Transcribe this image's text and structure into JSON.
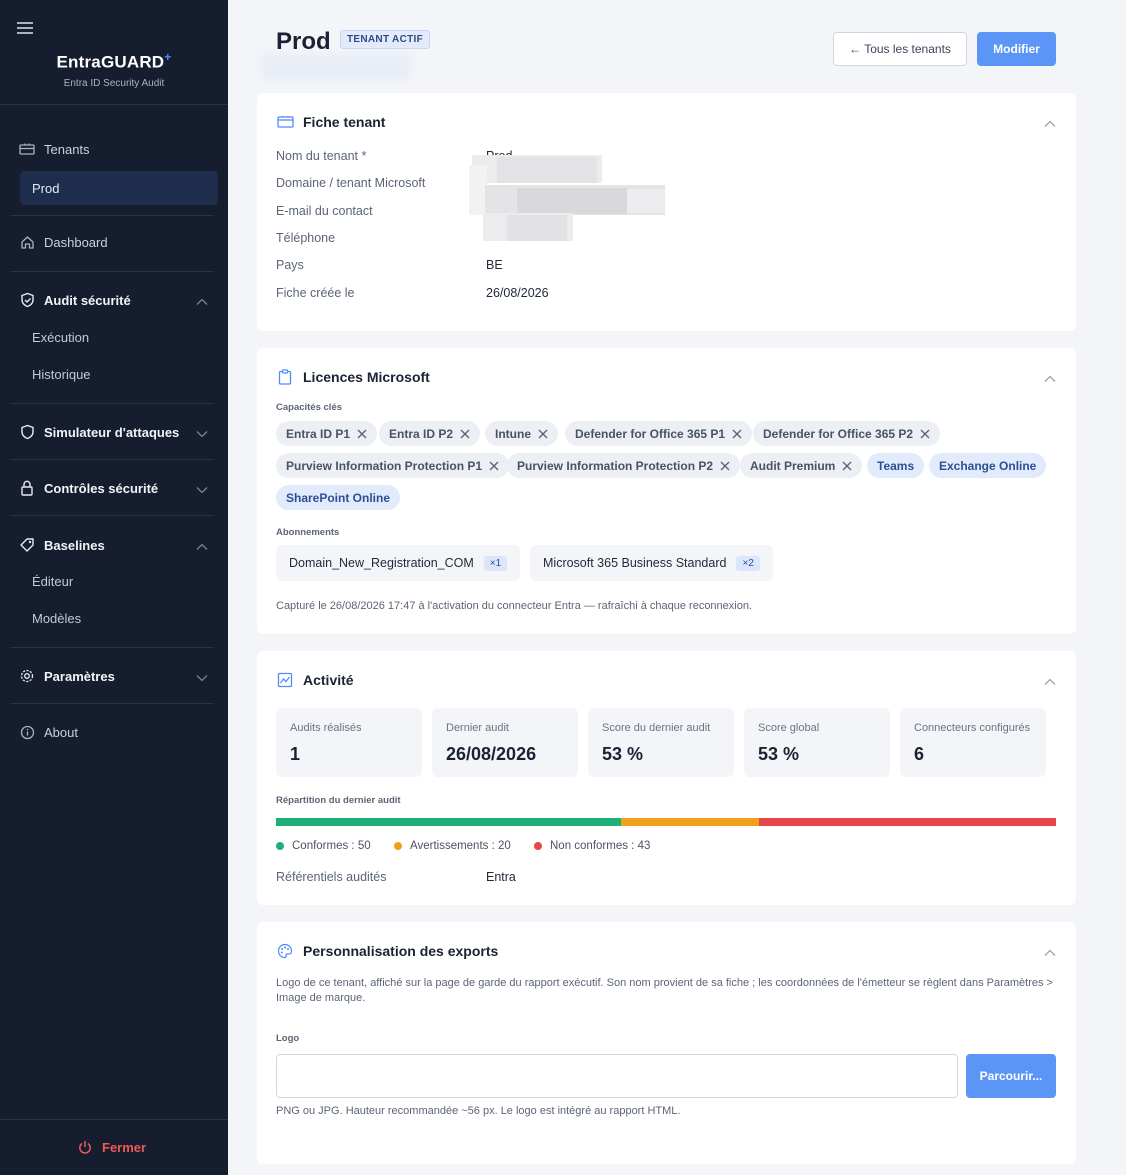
{
  "app": {
    "name": "EntraGUARD",
    "name_mark": "+",
    "subtitle": "Entra ID Security Audit"
  },
  "colors": {
    "sidebar_bg": "#151d2e",
    "accent": "#5b95f5",
    "danger": "#ef5a55",
    "ok": "#1fb07a",
    "warn": "#f1a01e",
    "fail": "#e84545"
  },
  "sidebar": {
    "tenants": "Tenants",
    "active_tenant": "Prod",
    "dashboard": "Dashboard",
    "audit": "Audit sécurité",
    "audit_children": [
      "Exécution",
      "Historique"
    ],
    "simulator": "Simulateur d'attaques",
    "controls": "Contrôles sécurité",
    "baselines": "Baselines",
    "baselines_children": [
      "Éditeur",
      "Modèles"
    ],
    "settings": "Paramètres",
    "about": "About",
    "logout": "Fermer"
  },
  "header": {
    "title": "Prod",
    "badge": "TENANT ACTIF",
    "back_button": "← Tous les tenants",
    "edit_button": "Modifier"
  },
  "fiche": {
    "title": "Fiche tenant",
    "fields": [
      {
        "label": "Nom du tenant *",
        "value": "Prod"
      },
      {
        "label": "Domaine / tenant Microsoft",
        "value": ""
      },
      {
        "label": "E-mail du contact",
        "value": ""
      },
      {
        "label": "Téléphone",
        "value": ""
      },
      {
        "label": "Pays",
        "value": "BE"
      },
      {
        "label": "Fiche créée le",
        "value": "26/08/2026"
      }
    ]
  },
  "licences": {
    "title": "Licences Microsoft",
    "capabilities_label": "Capacités clés",
    "capabilities": [
      {
        "label": "Entra ID P1",
        "removable": true
      },
      {
        "label": "Entra ID P2",
        "removable": true
      },
      {
        "label": "Intune",
        "removable": true
      },
      {
        "label": "Defender for Office 365 P1",
        "removable": true
      },
      {
        "label": "Defender for Office 365 P2",
        "removable": true
      },
      {
        "label": "Purview Information Protection P1",
        "removable": true
      },
      {
        "label": "Purview Information Protection P2",
        "removable": true
      },
      {
        "label": "Audit Premium",
        "removable": true
      },
      {
        "label": "Teams",
        "removable": false
      },
      {
        "label": "Exchange Online",
        "removable": false
      },
      {
        "label": "SharePoint Online",
        "removable": false
      }
    ],
    "subscriptions_label": "Abonnements",
    "subscriptions": [
      {
        "name": "Domain_New_Registration_COM",
        "count": "×1"
      },
      {
        "name": "Microsoft 365 Business Standard",
        "count": "×2"
      }
    ],
    "captured_note": "Capturé le 26/08/2026 17:47 à l'activation du connecteur Entra — rafraîchi à chaque reconnexion."
  },
  "activity": {
    "title": "Activité",
    "stats": [
      {
        "label": "Audits réalisés",
        "value": "1"
      },
      {
        "label": "Dernier audit",
        "value": "26/08/2026"
      },
      {
        "label": "Score du dernier audit",
        "value": "53 %"
      },
      {
        "label": "Score global",
        "value": "53 %"
      },
      {
        "label": "Connecteurs configurés",
        "value": "6"
      }
    ],
    "distribution_label": "Répartition du dernier audit",
    "distribution": [
      {
        "label": "Conformes : 50",
        "count": 50,
        "color": "#1fb07a"
      },
      {
        "label": "Avertissements : 20",
        "count": 20,
        "color": "#f1a01e"
      },
      {
        "label": "Non conformes : 43",
        "count": 43,
        "color": "#e84545"
      }
    ],
    "frameworks_label": "Référentiels audités",
    "frameworks_value": "Entra"
  },
  "exports": {
    "title": "Personnalisation des exports",
    "description": "Logo de ce tenant, affiché sur la page de garde du rapport exécutif. Son nom provient de sa fiche ; les coordonnées de l'émetteur se règlent dans Paramètres > Image de marque.",
    "logo_label": "Logo",
    "browse_button": "Parcourir...",
    "hint": "PNG ou JPG. Hauteur recommandée ~56 px. Le logo est intégré au rapport HTML."
  }
}
